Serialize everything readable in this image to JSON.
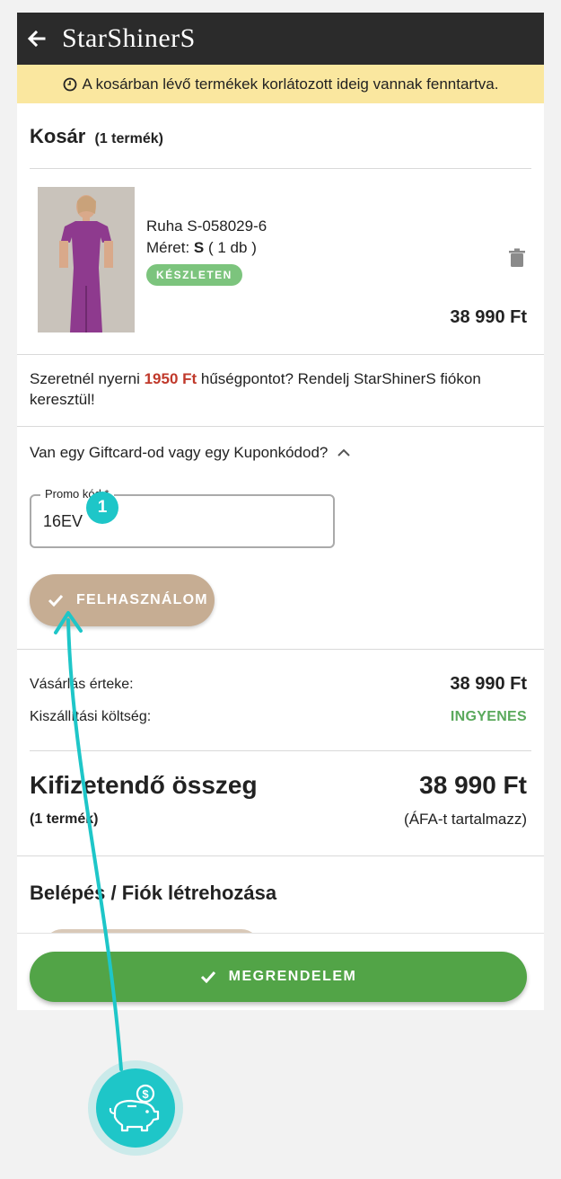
{
  "header": {
    "logo": "StarShinerS",
    "back_icon": "arrow-left-icon"
  },
  "notice": {
    "text": "A kosárban lévő termékek korlátozott ideig vannak fenntartva."
  },
  "cart": {
    "title": "Kosár",
    "count": "(1 termék)"
  },
  "item": {
    "name": "Ruha S-058029-6",
    "size_label": "Méret:",
    "size_value": "S",
    "qty": "( 1 db )",
    "stock_badge": "KÉSZLETEN",
    "price": "38 990 Ft"
  },
  "loyalty": {
    "pre": "Szeretnél nyerni ",
    "points": "1950 Ft",
    "post": " hűségpontot? Rendelj StarShinerS fiókon keresztül!"
  },
  "coupon": {
    "toggle": "Van egy Giftcard-od vagy egy Kuponkódod?",
    "label": "Promo kód *",
    "value": "16EV",
    "apply": "FELHASZNÁLOM",
    "step": "1"
  },
  "summary": {
    "subtotal_label": "Vásárlás érteke:",
    "subtotal": "38 990 Ft",
    "shipping_label": "Kiszállítási költség:",
    "shipping": "INGYENES",
    "total_label": "Kifizetendő összeg",
    "total": "38 990 Ft",
    "total_count": "(1 termék)",
    "vat_note": "(ÁFA-t tartalmazz)"
  },
  "login": {
    "title": "Belépés / Fiók létrehozása"
  },
  "order": {
    "button": "MEGRENDELEM"
  },
  "colors": {
    "accent": "#1ec6c8",
    "green": "#52a447",
    "beige": "#c6ad93",
    "notice": "#fae79f"
  }
}
